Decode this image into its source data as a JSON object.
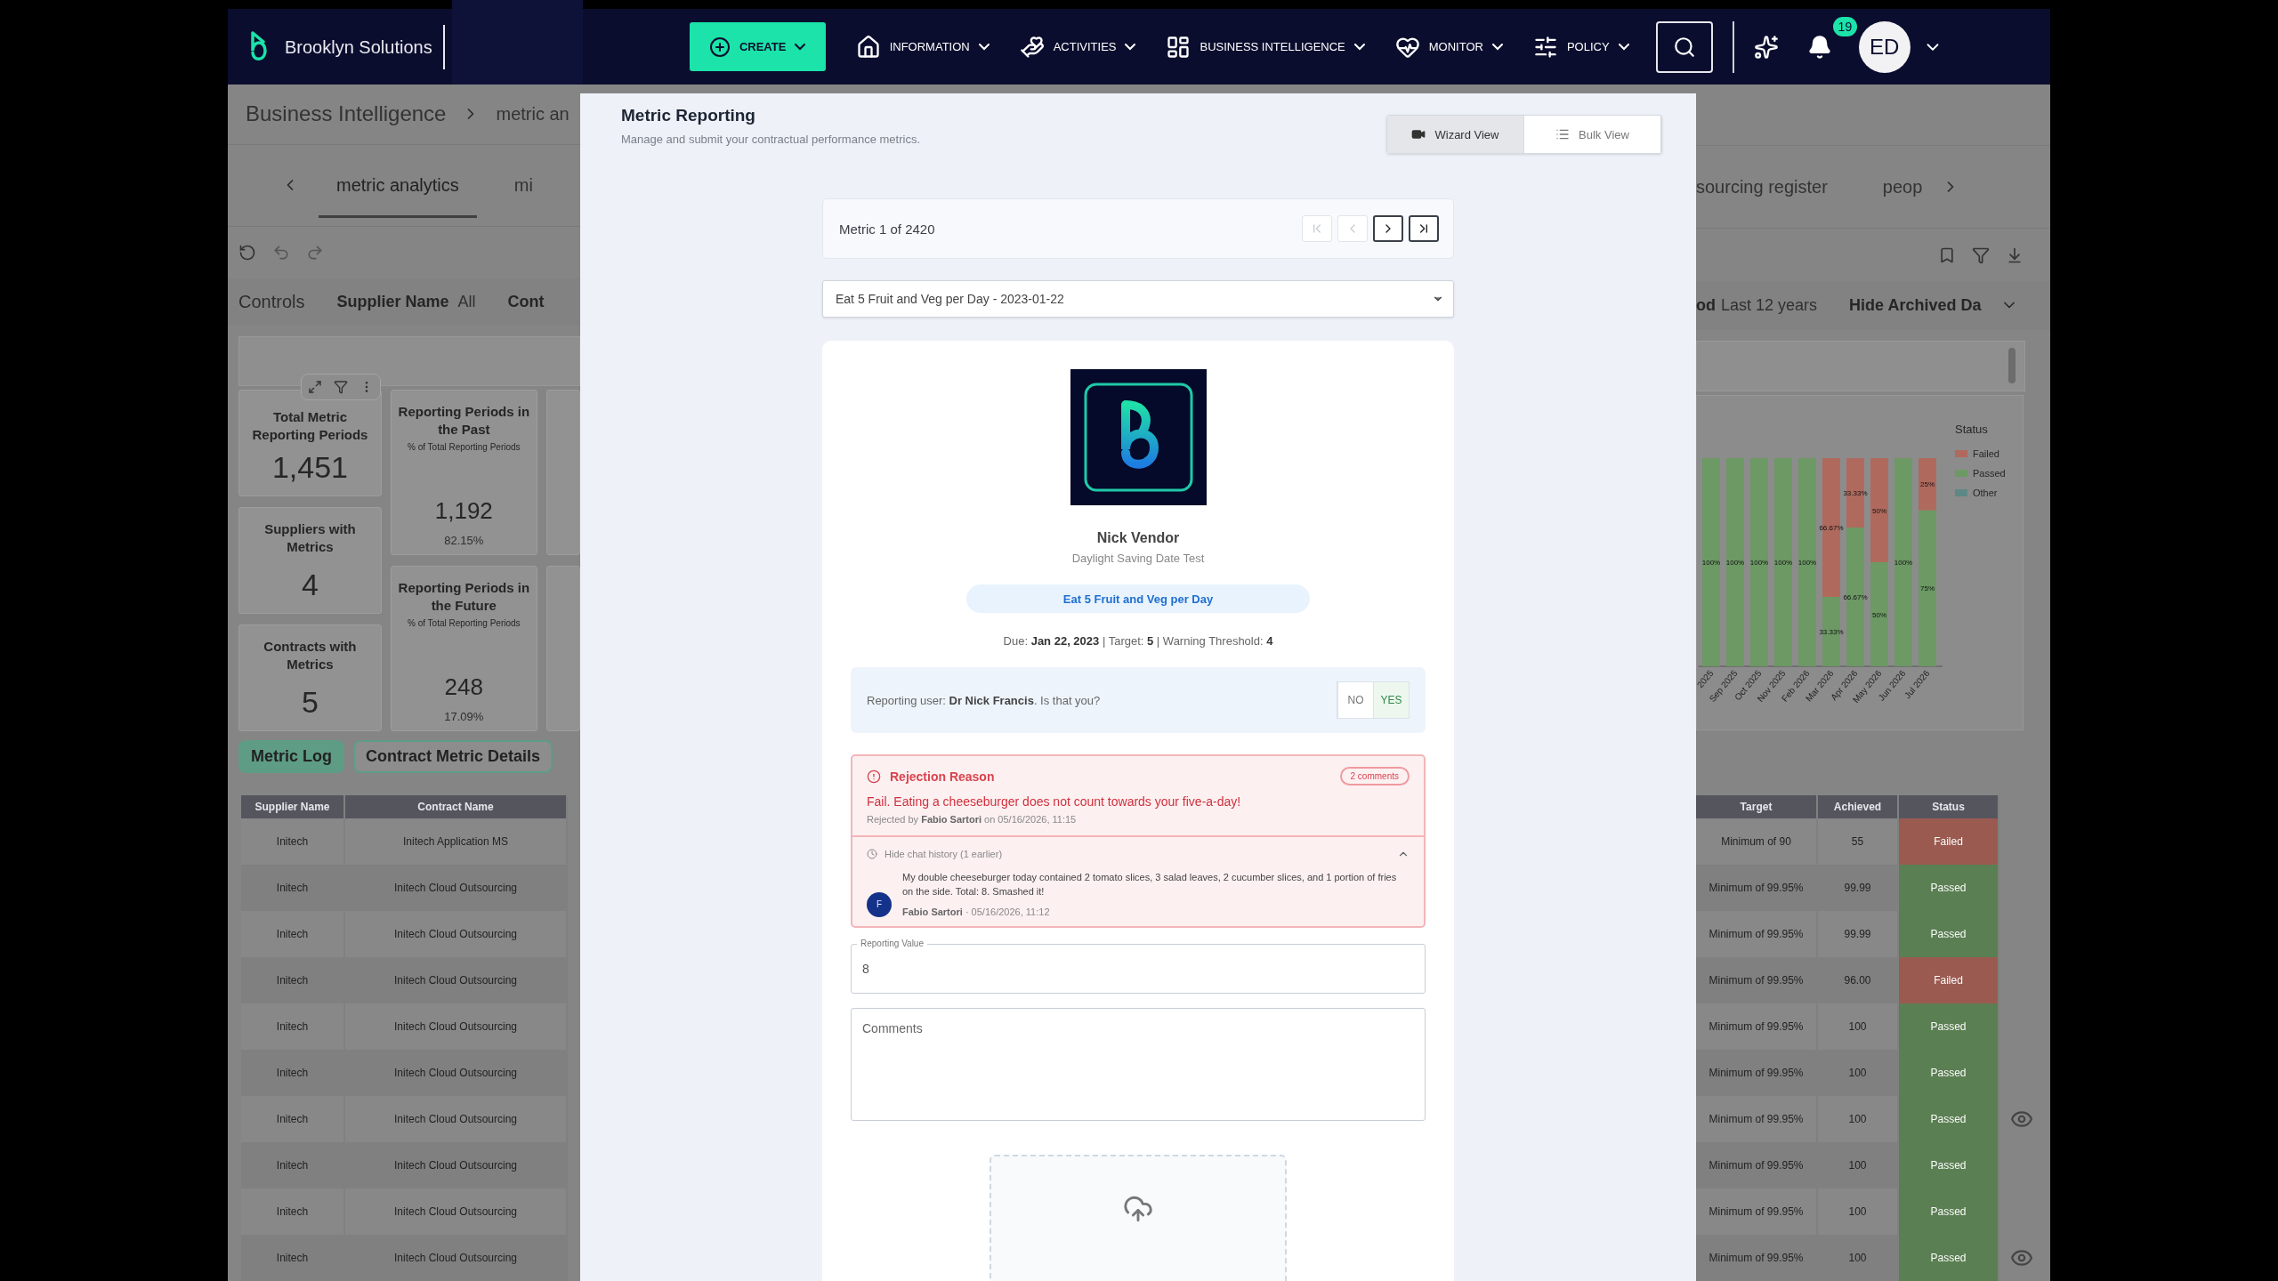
{
  "nav": {
    "brand": "Brooklyn Solutions",
    "create": "CREATE",
    "menus": [
      {
        "label": "INFORMATION"
      },
      {
        "label": "ACTIVITIES"
      },
      {
        "label": "BUSINESS INTELLIGENCE"
      },
      {
        "label": "MONITOR"
      },
      {
        "label": "POLICY"
      }
    ],
    "notifications": "19",
    "avatar": "ED"
  },
  "background": {
    "breadcrumb": [
      "Business Intelligence",
      "metric an"
    ],
    "tabs_left": [
      {
        "label": "metric analytics",
        "selected": true
      },
      {
        "label": "mi",
        "selected": false
      }
    ],
    "tabs_right": [
      {
        "label": "sourcing register",
        "selected": false
      },
      {
        "label": "peop",
        "selected": false
      }
    ],
    "controls_left": {
      "title": "Controls",
      "filters": [
        {
          "label": "Supplier Name",
          "value": "All"
        },
        {
          "label": "Cont"
        }
      ]
    },
    "controls_right": {
      "filters": [
        {
          "label": "od",
          "value": "Last 12 years"
        },
        {
          "label": "Hide Archived Da"
        }
      ]
    },
    "kpis_first": [
      {
        "title": "Total Metric Reporting Periods",
        "value": "1,451"
      },
      {
        "title": "Suppliers with Metrics",
        "value": "4"
      },
      {
        "title": "Contracts with Metrics",
        "value": "5"
      }
    ],
    "kpis_second": [
      {
        "title": "Reporting Periods in the Past",
        "subtitle": "% of Total Reporting Periods",
        "value": "1,192",
        "share": "82.15%"
      },
      {
        "title": "Reporting Periods in the Future",
        "subtitle": "% of Total Reporting Periods",
        "value": "248",
        "share": "17.09%"
      }
    ],
    "chart": {
      "legend_title": "Status",
      "chart_data": {
        "type": "bar",
        "stacked": true,
        "legend": "right",
        "categories": [
          "2025",
          "Sep 2025",
          "Oct 2025",
          "Nov 2025",
          "Feb 2026",
          "Mar 2026",
          "Apr 2026",
          "May 2026",
          "Jun 2026",
          "Jul 2026"
        ],
        "series": [
          {
            "name": "Failed",
            "color": "#b0695d",
            "values": [
              null,
              null,
              null,
              null,
              null,
              66.67,
              33.33,
              50,
              null,
              25
            ],
            "value_labels": [
              null,
              null,
              null,
              null,
              null,
              "66.67%",
              "33.33%",
              "50%",
              null,
              "25%"
            ]
          },
          {
            "name": "Passed",
            "color": "#6c9964",
            "values": [
              100,
              100,
              100,
              100,
              100,
              33.33,
              66.67,
              50,
              100,
              75
            ],
            "value_labels": [
              "100%",
              "100%",
              "100%",
              "100%",
              "100%",
              "33.33%",
              "66.67%",
              "50%",
              "100%",
              "75%"
            ]
          },
          {
            "name": "Other",
            "color": "#5e8886",
            "values": [
              null,
              null,
              null,
              null,
              null,
              null,
              null,
              null,
              null,
              null
            ]
          }
        ]
      }
    },
    "subtabs": [
      {
        "label": "Metric Log",
        "selected": true
      },
      {
        "label": "Contract Metric Details",
        "selected": false
      }
    ],
    "table": {
      "left_columns": [
        "Supplier Name",
        "Contract Name"
      ],
      "right_columns": [
        "Target",
        "Achieved",
        "Status"
      ],
      "rows": [
        {
          "supplier": "Initech",
          "contract": "Initech Application MS",
          "target": "Minimum of 90",
          "achieved": "55",
          "status": "Failed",
          "failed": true,
          "viewable": false
        },
        {
          "supplier": "Initech",
          "contract": "Initech Cloud Outsourcing",
          "target": "Minimum of 99.95%",
          "achieved": "99.99",
          "status": "Passed",
          "failed": false,
          "viewable": false
        },
        {
          "supplier": "Initech",
          "contract": "Initech Cloud Outsourcing",
          "target": "Minimum of 99.95%",
          "achieved": "99.99",
          "status": "Passed",
          "failed": false,
          "viewable": false
        },
        {
          "supplier": "Initech",
          "contract": "Initech Cloud Outsourcing",
          "target": "Minimum of 99.95%",
          "achieved": "96.00",
          "status": "Failed",
          "failed": true,
          "viewable": false
        },
        {
          "supplier": "Initech",
          "contract": "Initech Cloud Outsourcing",
          "target": "Minimum of 99.95%",
          "achieved": "100",
          "status": "Passed",
          "failed": false,
          "viewable": false
        },
        {
          "supplier": "Initech",
          "contract": "Initech Cloud Outsourcing",
          "target": "Minimum of 99.95%",
          "achieved": "100",
          "status": "Passed",
          "failed": false,
          "viewable": false
        },
        {
          "supplier": "Initech",
          "contract": "Initech Cloud Outsourcing",
          "target": "Minimum of 99.95%",
          "achieved": "100",
          "status": "Passed",
          "failed": false,
          "viewable": true
        },
        {
          "supplier": "Initech",
          "contract": "Initech Cloud Outsourcing",
          "target": "Minimum of 99.95%",
          "achieved": "100",
          "status": "Passed",
          "failed": false,
          "viewable": false
        },
        {
          "supplier": "Initech",
          "contract": "Initech Cloud Outsourcing",
          "target": "Minimum of 99.95%",
          "achieved": "100",
          "status": "Passed",
          "failed": false,
          "viewable": false
        },
        {
          "supplier": "Initech",
          "contract": "Initech Cloud Outsourcing",
          "target": "Minimum of 99.95%",
          "achieved": "100",
          "status": "Passed",
          "failed": false,
          "viewable": true
        }
      ]
    }
  },
  "modal": {
    "title": "Metric Reporting",
    "subtitle": "Manage and submit your contractual performance metrics.",
    "views": [
      {
        "label": "Wizard View",
        "selected": true
      },
      {
        "label": "Bulk View",
        "selected": false
      }
    ],
    "pager": {
      "label": "Metric 1 of 2420",
      "buttons": [
        {
          "disabled": true
        },
        {
          "disabled": true
        },
        {
          "disabled": false
        },
        {
          "disabled": false
        }
      ]
    },
    "metric_select": "Eat 5 Fruit and Veg per Day - 2023-01-22",
    "vendor": {
      "name": "Nick Vendor",
      "contract": "Daylight Saving Date Test"
    },
    "metric_pill": "Eat 5 Fruit and Veg per Day",
    "due_line": "Due: **Jan 22, 2023** | Target: **5** | Warning Threshold: **4**",
    "confirm": {
      "text": "Reporting user: **Dr Nick Francis**. Is that you?",
      "options": [
        {
          "label": "NO",
          "selected": false
        },
        {
          "label": "YES",
          "selected": true
        }
      ]
    },
    "rejection": {
      "title": "Rejection Reason",
      "badge": "2 comments",
      "reason": "Fail. Eating a cheeseburger does not count towards your five-a-day!",
      "meta": "Rejected by **Fabio Sartori** on 05/16/2026, 11:15",
      "history_toggle": "Hide chat history (1 earlier)",
      "expanded": true,
      "messages": [
        {
          "avatar": "F",
          "text": "My double cheeseburger today contained 2 tomato slices, 3 salad leaves, 2 cucumber slices, and 1 portion of fries on the side. Total: 8. Smashed it!",
          "meta": "**Fabio Sartori** · 05/16/2026, 11:12"
        }
      ]
    },
    "reporting_value": {
      "label": "Reporting Value",
      "value": "8"
    },
    "comments": {
      "placeholder": "Comments"
    }
  }
}
